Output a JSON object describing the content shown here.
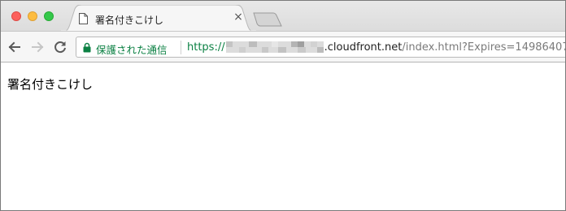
{
  "window": {
    "traffic_lights": [
      "close",
      "minimize",
      "maximize"
    ],
    "colors": {
      "close": "#fc605c",
      "minimize": "#fdbc40",
      "maximize": "#34c84a"
    }
  },
  "tab": {
    "title": "署名付きこけし",
    "icon": "page-icon",
    "close_label": "×"
  },
  "toolbar": {
    "back_icon": "back-arrow-icon",
    "forward_icon": "forward-arrow-icon",
    "reload_icon": "reload-icon"
  },
  "address_bar": {
    "security_label": "保護された通信",
    "security_color": "#0b8043",
    "scheme": "https://",
    "host_suffix": ".cloudfront.net",
    "path": "/index.html?Expires=14986407"
  },
  "page": {
    "body_text": "署名付きこけし"
  }
}
